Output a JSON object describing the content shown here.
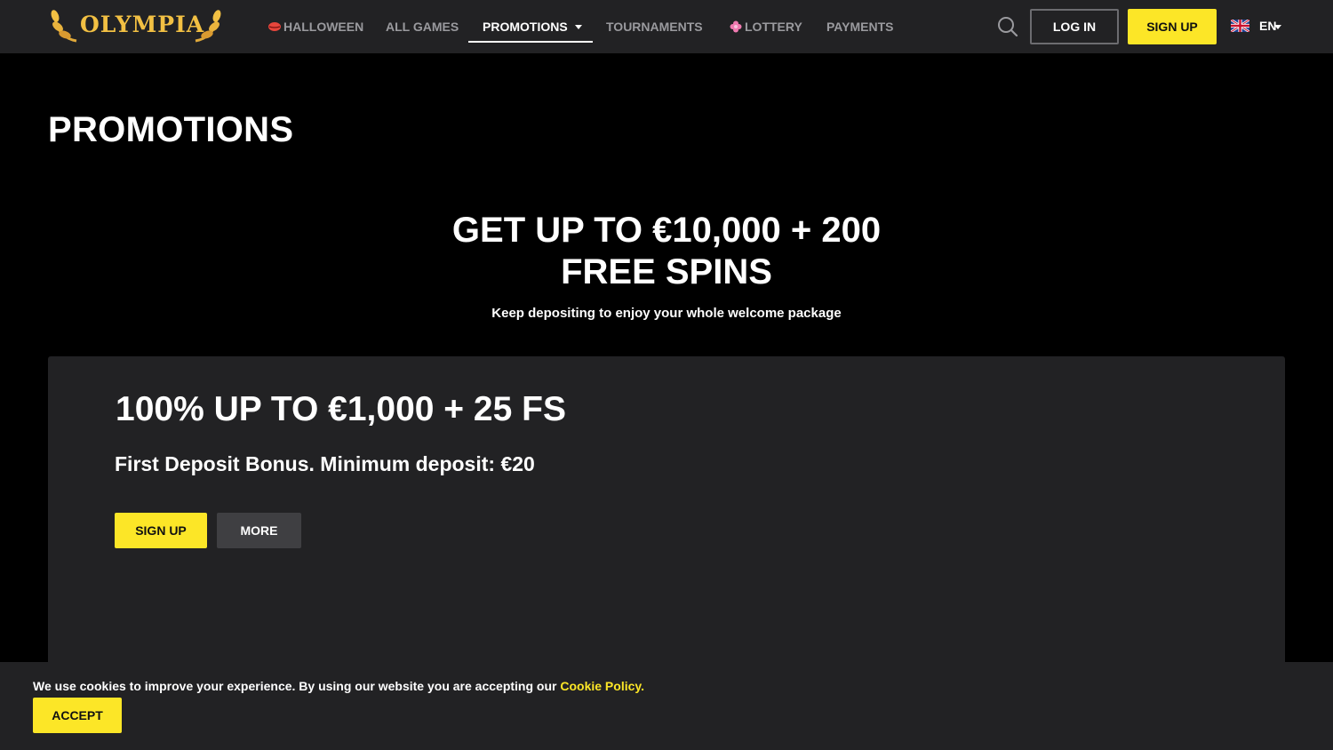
{
  "header": {
    "logo_text": "OLYMPIA",
    "nav": [
      {
        "label": "HALLOWEEN",
        "icon": "lips-icon"
      },
      {
        "label": "ALL GAMES"
      },
      {
        "label": "PROMOTIONS",
        "active": true
      },
      {
        "label": "TOURNAMENTS"
      },
      {
        "label": "LOTTERY",
        "icon": "flower-icon"
      },
      {
        "label": "PAYMENTS"
      }
    ],
    "search_icon": "search-icon",
    "login_label": "LOG IN",
    "signup_label": "SIGN UP",
    "language": {
      "code": "EN",
      "flag": "uk-flag-icon"
    }
  },
  "page": {
    "title": "PROMOTIONS"
  },
  "hero": {
    "title_line1": "GET UP TO €10,000 + 200",
    "title_line2": "FREE SPINS",
    "subtitle": "Keep depositing to enjoy your whole welcome package"
  },
  "promo_card": {
    "title": "100% UP TO €1,000 + 25 FS",
    "subtitle": "First Deposit Bonus. Minimum deposit: €20",
    "signup_label": "SIGN UP",
    "more_label": "MORE"
  },
  "cookie": {
    "text": "We use cookies to improve your experience. By using our website you are accepting our ",
    "link": "Cookie Policy.",
    "accept_label": "ACCEPT"
  },
  "colors": {
    "accent": "#fce627",
    "logo_gold": "#f2c043",
    "header_bg": "#222224",
    "page_bg": "#000000"
  }
}
